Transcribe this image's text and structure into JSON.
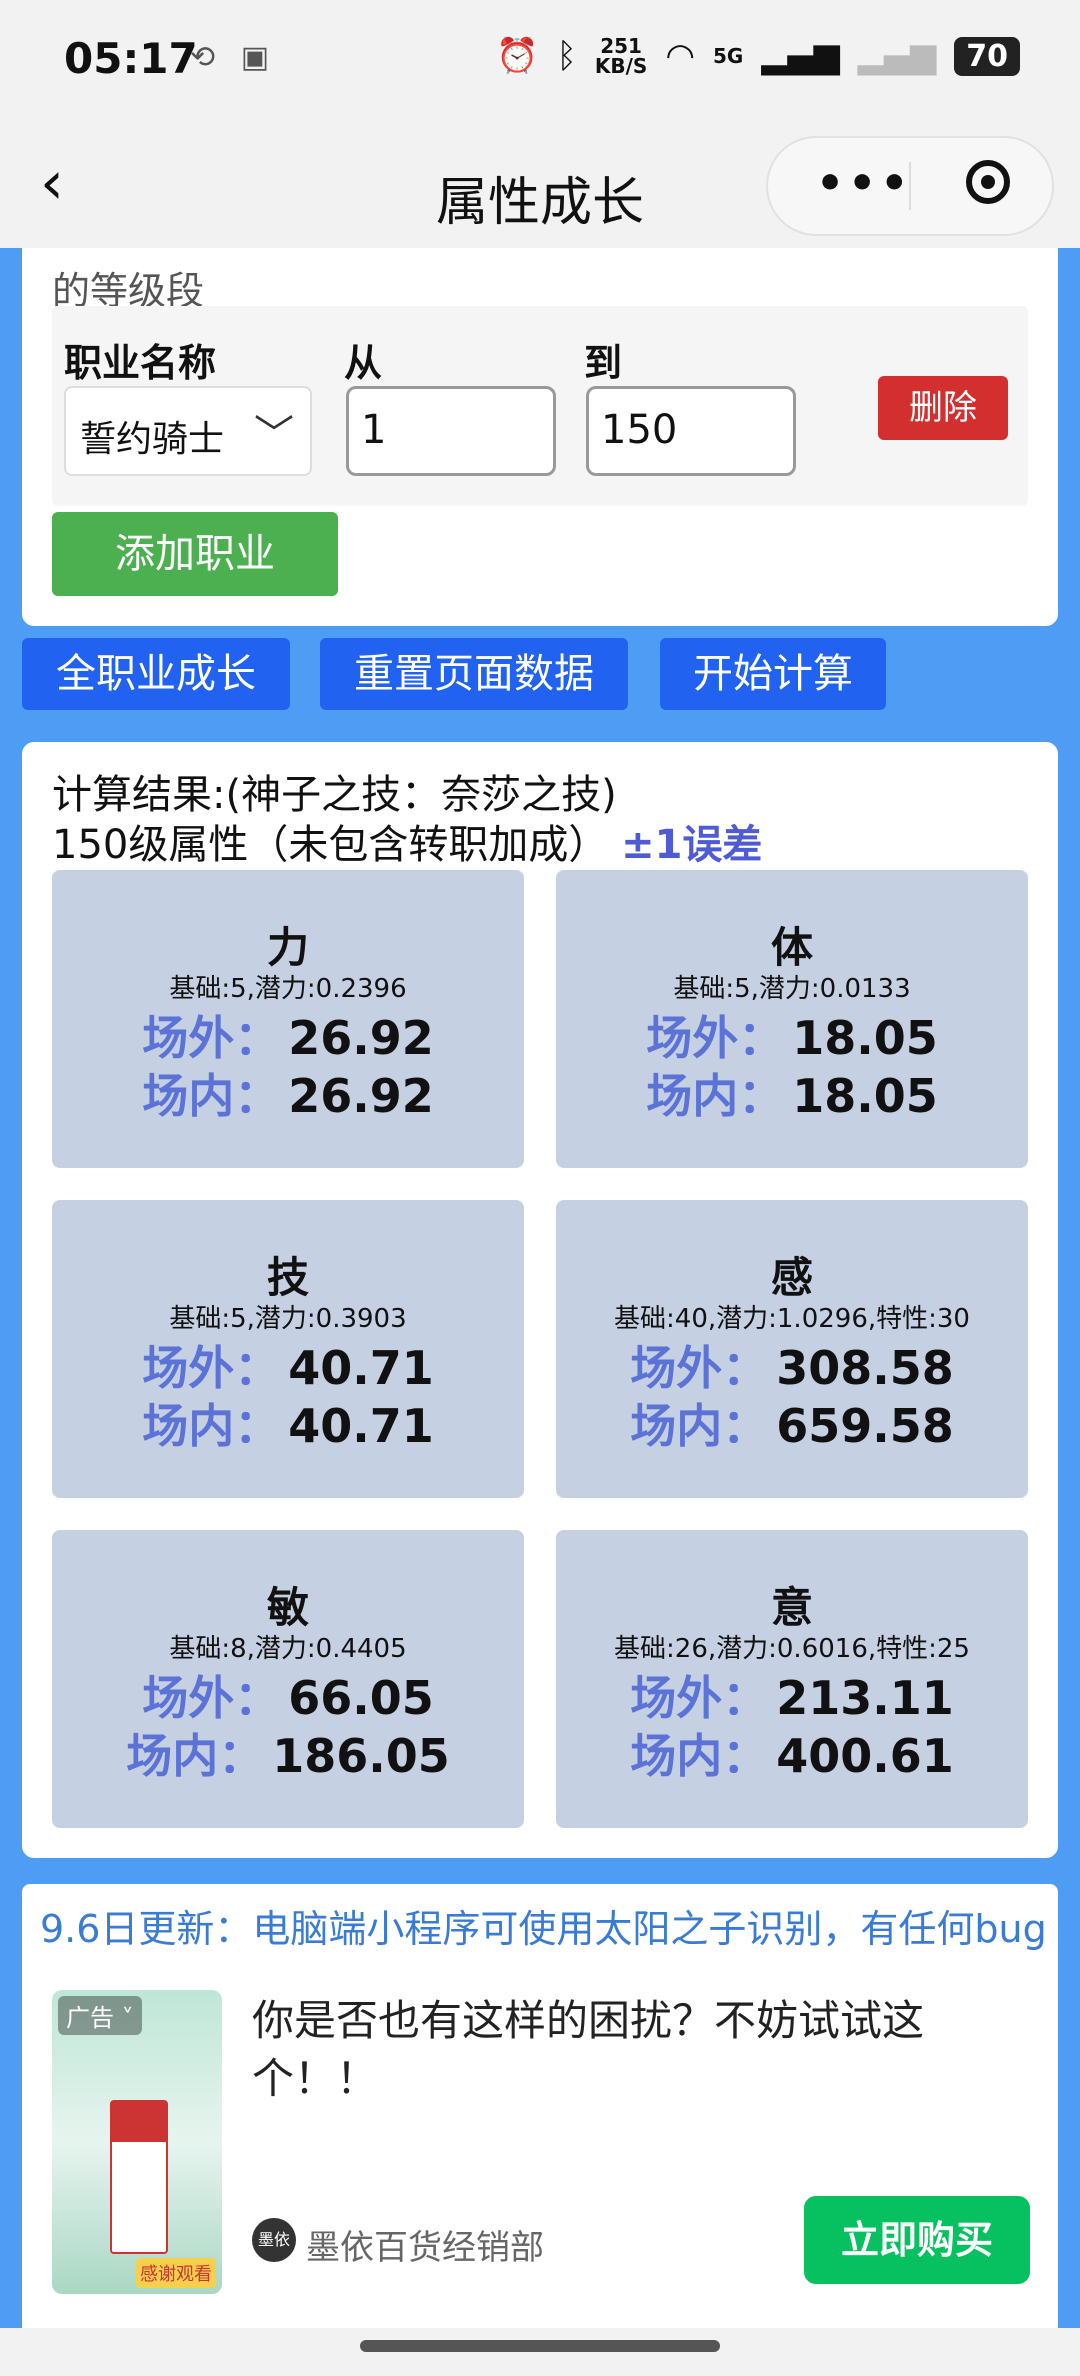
{
  "status_bar": {
    "time": "05:17",
    "net_speed_value": "251",
    "net_speed_unit": "KB/S",
    "network": "5G",
    "battery": "70"
  },
  "nav": {
    "title": "属性成长"
  },
  "job_section": {
    "cut_text": "的等级段",
    "label_job": "职业名称",
    "label_from": "从",
    "label_to": "到",
    "job_selected": "誓约骑士",
    "from_value": "1",
    "to_value": "150",
    "delete_label": "删除",
    "add_label": "添加职业"
  },
  "actions": {
    "all_jobs": "全职业成长",
    "reset": "重置页面数据",
    "compute": "开始计算"
  },
  "result": {
    "title": "计算结果:(神子之技：奈莎之技)",
    "subtitle": "150级属性（未包含转职加成）",
    "error_note": "±1误差",
    "outside_label": "场外：",
    "inside_label": "场内：",
    "stats": [
      {
        "name": "力",
        "base": "基础:5,潜力:0.2396",
        "outside": "26.92",
        "inside": "26.92"
      },
      {
        "name": "体",
        "base": "基础:5,潜力:0.0133",
        "outside": "18.05",
        "inside": "18.05"
      },
      {
        "name": "技",
        "base": "基础:5,潜力:0.3903",
        "outside": "40.71",
        "inside": "40.71"
      },
      {
        "name": "感",
        "base": "基础:40,潜力:1.0296,特性:30",
        "outside": "308.58",
        "inside": "659.58"
      },
      {
        "name": "敏",
        "base": "基础:8,潜力:0.4405",
        "outside": "66.05",
        "inside": "186.05"
      },
      {
        "name": "意",
        "base": "基础:26,潜力:0.6016,特性:25",
        "outside": "213.11",
        "inside": "400.61"
      }
    ]
  },
  "notice": {
    "text": "9.6日更新：电脑端小程序可使用太阳之子识别，有任何bug"
  },
  "ad": {
    "tag": "广告",
    "text": "你是否也有这样的困扰？不妨试试这个！！",
    "brand_logo": "墨依",
    "brand": "墨依百货经销部",
    "cta": "立即购买",
    "sticker": "感谢观看"
  }
}
